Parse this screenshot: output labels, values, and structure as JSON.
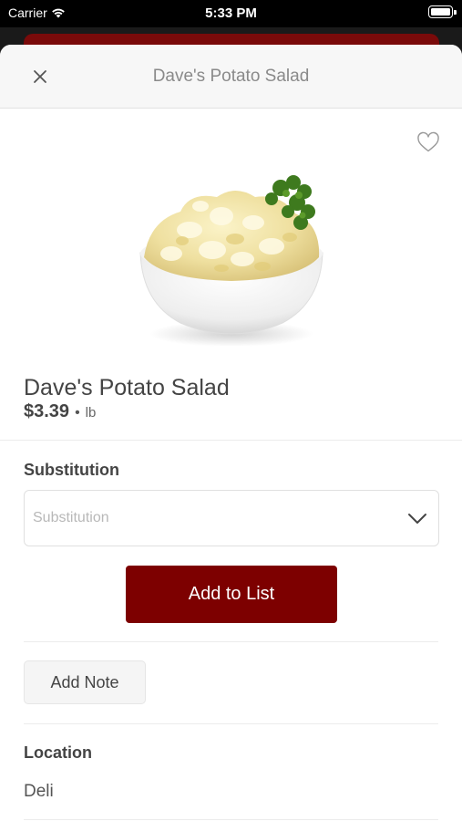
{
  "status_bar": {
    "carrier": "Carrier",
    "time": "5:33 PM",
    "wifi_icon": "wifi-icon",
    "battery_icon": "battery-icon"
  },
  "nav": {
    "title": "Dave's Potato Salad",
    "close_icon": "close-icon"
  },
  "product": {
    "name": "Dave's Potato Salad",
    "price": "$3.39",
    "separator": "•",
    "unit": "lb",
    "favorite_icon": "heart-outline-icon"
  },
  "substitution": {
    "label": "Substitution",
    "placeholder": "Substitution",
    "chevron_icon": "chevron-down-icon"
  },
  "actions": {
    "add_to_list": "Add to List",
    "add_note": "Add Note"
  },
  "location": {
    "label": "Location",
    "value": "Deli"
  },
  "colors": {
    "brand": "#7d0000",
    "status_bar": "#000000",
    "nav_background": "#f7f7f7"
  }
}
